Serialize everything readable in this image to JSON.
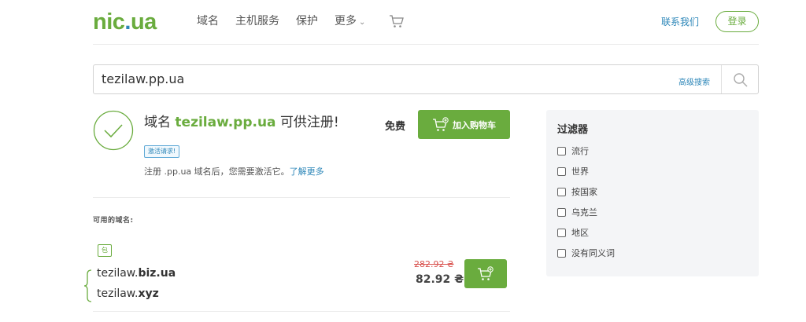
{
  "header": {
    "logo_main": "nic",
    "logo_dot": ".",
    "logo_tld": "ua",
    "nav": [
      "域名",
      "主机服务",
      "保护",
      "更多"
    ],
    "contact": "联系我们",
    "login": "登录"
  },
  "search": {
    "value": "tezilaw.pp.ua",
    "advanced": "高级搜索"
  },
  "result": {
    "prefix": "域名",
    "domain": "tezilaw.pp.ua",
    "suffix": "可供注册!",
    "badge": "激活请求!",
    "note": "注册 .pp.ua 域名后，您需要激活它。",
    "learn_more": "了解更多",
    "price": "免费",
    "add_to_cart": "加入购物车"
  },
  "available": {
    "label": "可用的域名:",
    "package_tag": "包",
    "domains": [
      {
        "name": "tezilaw.",
        "tld": "biz.ua"
      },
      {
        "name": "tezilaw.",
        "tld": "xyz"
      }
    ],
    "old_price": "282.92 ₴",
    "new_price": "82.92 ₴"
  },
  "filter": {
    "title": "过滤器",
    "items": [
      "流行",
      "世界",
      "按国家",
      "乌克兰",
      "地区",
      "没有同义词"
    ]
  },
  "colors": {
    "brand_green": "#6aac3e",
    "link_blue": "#2c86b8",
    "strike_red": "#d9534f"
  }
}
